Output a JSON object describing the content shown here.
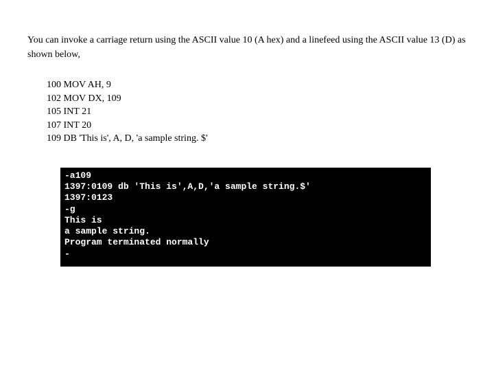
{
  "intro": "You can invoke a carriage return using the ASCII value 10 (A hex) and a linefeed using the ASCII value 13 (D) as shown below,",
  "code": {
    "l1": "100 MOV AH, 9",
    "l2": "102 MOV DX, 109",
    "l3": "105 INT 21",
    "l4": "107 INT 20",
    "l5": "109 DB 'This is', A, D, 'a sample string. $'"
  },
  "terminal": {
    "l1": "-a109",
    "l2": "1397:0109 db 'This is',A,D,'a sample string.$'",
    "l3": "1397:0123",
    "l4": "-g",
    "l5": "This is",
    "l6": "a sample string.",
    "l7": "Program terminated normally",
    "l8": "-"
  }
}
